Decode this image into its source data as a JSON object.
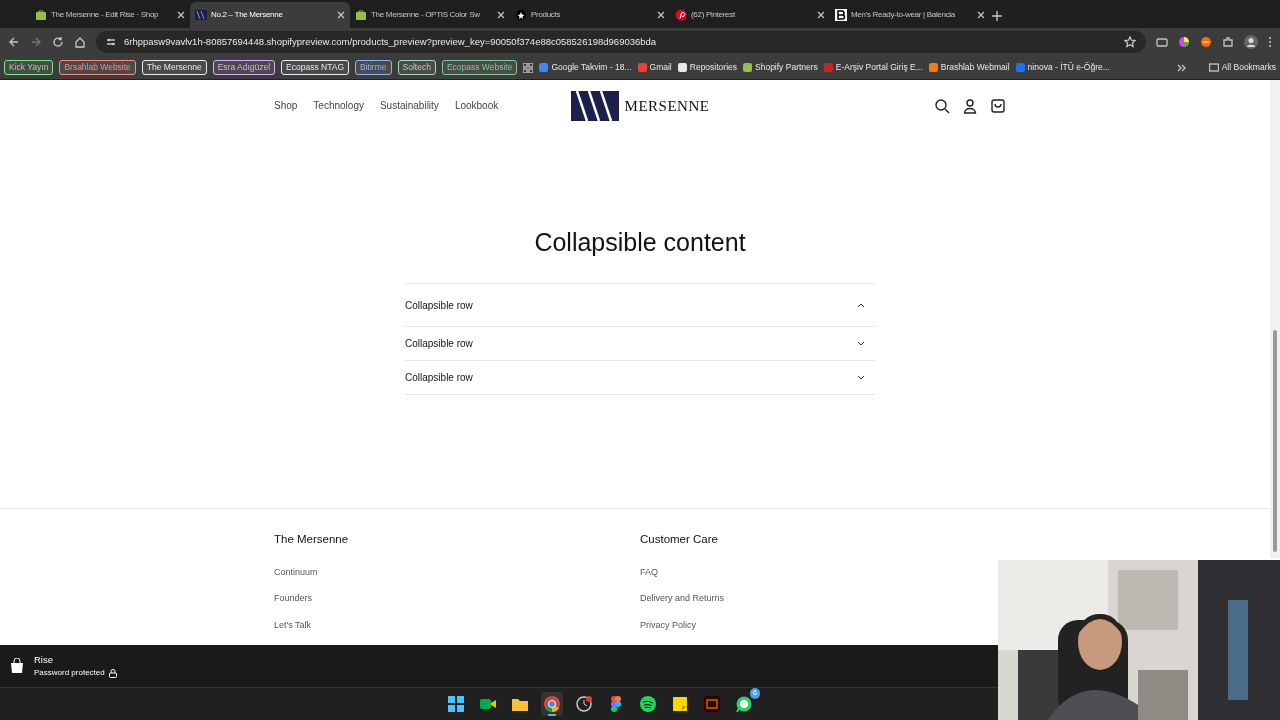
{
  "browser": {
    "tabs": [
      {
        "title": "The Mersenne - Edit Rise · Shop",
        "selected": false,
        "kind": "shopify"
      },
      {
        "title": "No.2 – The Mersenne",
        "selected": true,
        "kind": "mersenne"
      },
      {
        "title": "The Mersenne - OPTIS Color Sw",
        "selected": false,
        "kind": "shopify"
      },
      {
        "title": "Products",
        "selected": false,
        "kind": "dark"
      },
      {
        "title": "(62) Pinterest",
        "selected": false,
        "kind": "pinterest"
      },
      {
        "title": "Men's Ready-to-wear | Balencia",
        "selected": false,
        "kind": "letter"
      }
    ],
    "address": "6rhppasw9vavlv1h-80857694448.shopifypreview.com/products_preview?preview_key=90050f374e88c058526198d969036bda",
    "bookmarks": [
      {
        "label": "Kick Yayın",
        "kind": "tag",
        "color": "#7ee787"
      },
      {
        "label": "Brsahlab Website",
        "kind": "tag",
        "color": "#ff8a80"
      },
      {
        "label": "The Mersenne",
        "kind": "tag",
        "color": "#e8eaed"
      },
      {
        "label": "Esra Adıgüzel",
        "kind": "tag",
        "color": "#d7aefb"
      },
      {
        "label": "Ecopass NTAG",
        "kind": "tag",
        "color": "#e8eaed"
      },
      {
        "label": "Bitirme",
        "kind": "tag",
        "color": "#8ab4f8"
      },
      {
        "label": "Soltech",
        "kind": "tag",
        "color": "#a8dab5"
      },
      {
        "label": "Ecopass Website",
        "kind": "tag",
        "color": "#81c995"
      },
      {
        "label": "Google Takvim - 18...",
        "kind": "link",
        "color": "#4285f4"
      },
      {
        "label": "Gmail",
        "kind": "link",
        "color": "#ea4335"
      },
      {
        "label": "Repositories",
        "kind": "link",
        "color": "#e8eaed"
      },
      {
        "label": "Shopify Partners",
        "kind": "link",
        "color": "#95bf47"
      },
      {
        "label": "E-Arşiv Portal Giriş E...",
        "kind": "link",
        "color": "#c62828"
      },
      {
        "label": "Brashlab Webmail",
        "kind": "link",
        "color": "#f57c00"
      },
      {
        "label": "ninova - İTÜ e-Öğre...",
        "kind": "link",
        "color": "#1a73e8"
      }
    ],
    "all_bookmarks": "All Bookmarks"
  },
  "store": {
    "nav": [
      "Shop",
      "Technology",
      "Sustainability",
      "Lookbook"
    ],
    "logo": "MERSENNE",
    "heading": "Collapsible content",
    "rows": [
      {
        "label": "Collapsible row",
        "expanded": true
      },
      {
        "label": "Collapsible row",
        "expanded": false
      },
      {
        "label": "Collapsible row",
        "expanded": false
      }
    ],
    "footer": [
      {
        "title": "The Mersenne",
        "links": [
          "Continuum",
          "Founders",
          "Let's Talk"
        ]
      },
      {
        "title": "Customer Care",
        "links": [
          "FAQ",
          "Delivery and Returns",
          "Privacy Policy"
        ]
      }
    ]
  },
  "admin_bar": {
    "theme": "Rise",
    "status": "Password protected"
  },
  "taskbar": {
    "apps": [
      {
        "kind": "windows",
        "active": false
      },
      {
        "kind": "meet",
        "active": false
      },
      {
        "kind": "folder",
        "active": false
      },
      {
        "kind": "chrome",
        "active": true
      },
      {
        "kind": "clock",
        "active": false
      },
      {
        "kind": "figma",
        "active": false
      },
      {
        "kind": "spotify",
        "active": false
      },
      {
        "kind": "notes",
        "active": false
      },
      {
        "kind": "illustrator",
        "active": false
      },
      {
        "kind": "whatsapp",
        "active": false,
        "badge": "6"
      }
    ]
  }
}
